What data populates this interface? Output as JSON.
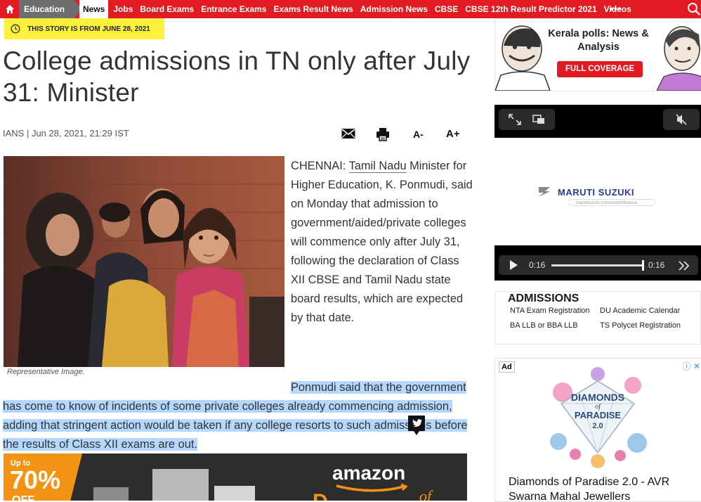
{
  "nav": {
    "section": "Education",
    "links": [
      "News",
      "Jobs",
      "Board Exams",
      "Entrance Exams",
      "Exams Result News",
      "Admission News",
      "CBSE",
      "CBSE 12th Result Predictor 2021",
      "Videos"
    ],
    "more": "•••"
  },
  "notice": "THIS STORY IS FROM JUNE 28, 2021",
  "article": {
    "title": "College admissions in TN only after July 31: Minister",
    "byline": "IANS | Jun 28, 2021, 21:29 IST",
    "font_decrease": "A-",
    "font_increase": "A+",
    "caption": "Representative Image.",
    "p1_lead": "CHENNAI: ",
    "p1_link": "Tamil Nadu",
    "p1_rest": " Minister for Higher Education, K. Ponmudi, said on Monday that admission to government/aided/private colleges will commence only after July 31, following the declaration of Class XII CBSE and Tamil Nadu state board results, which are expected by that date.",
    "p2": "Ponmudi said that the government has come to know of incidents of some private colleges already commencing admission, adding that stringent action would be taken if any college resorts to such admissions before the results of Class XII exams are out."
  },
  "amazon_ad": {
    "upto": "Up to",
    "pct": "70%",
    "off": "OFF",
    "brand": "amazon",
    "tag1": "D",
    "tag2": "of"
  },
  "kerala": {
    "title": "Kerala polls: News & Analysis",
    "button": "FULL COVERAGE"
  },
  "video": {
    "brand": "MARUTI SUZUKI",
    "url": "marutisuzuki.com/customfinance",
    "time_elapsed": "0:16",
    "time_total": "0:16",
    "progress": 1.0
  },
  "admissions": {
    "title": "ADMISSIONS",
    "links": [
      "NTA Exam Registration",
      "DU Academic Calendar",
      "BA LLB or BBA LLB",
      "TS Polycet Registration"
    ]
  },
  "side_ad": {
    "label": "Ad",
    "line1": "DIAMONDS",
    "line2": "of",
    "line3": "PARADISE",
    "line4": "2.0",
    "title": "Diamonds of Paradise 2.0 - AVR",
    "subtitle": "Swarna Mahal Jewellers"
  },
  "colors": {
    "brand_red": "#e21b22",
    "notice_yellow": "#fff13b",
    "highlight": "#b4d7ff"
  }
}
